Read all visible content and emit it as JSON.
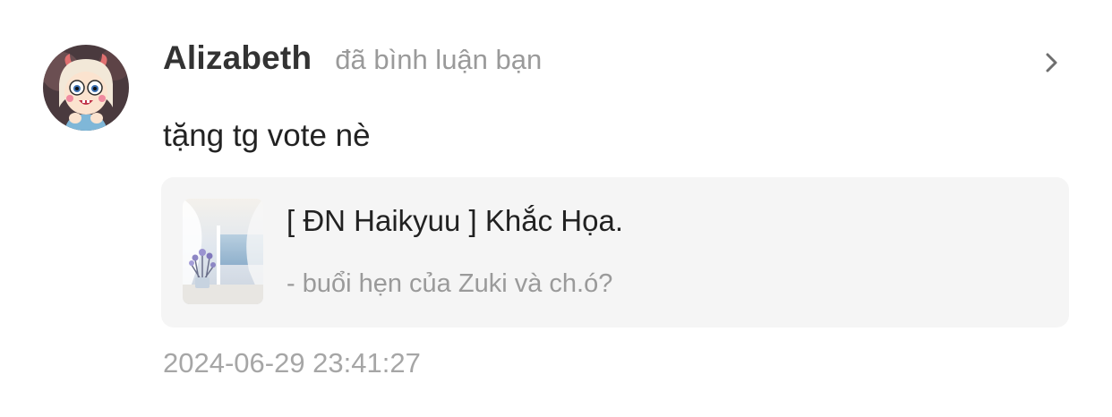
{
  "notification": {
    "user": {
      "name": "Alizabeth",
      "avatar_icon": "cartoon-avatar-icon"
    },
    "action": "đã bình luận bạn",
    "comment": "tặng tg vote nè",
    "story": {
      "title": "[ ĐN Haikyuu ] Khắc Họa.",
      "chapter": "- buổi hẹn của Zuki và ch.ó?",
      "cover_icon": "story-cover-image"
    },
    "timestamp": "2024-06-29 23:41:27",
    "open_icon": "chevron-right-icon"
  },
  "colors": {
    "background": "#ffffff",
    "card_background": "#f5f5f5",
    "primary_text": "#333333",
    "secondary_text": "#9a9a9a",
    "timestamp_text": "#a6a6a6"
  }
}
